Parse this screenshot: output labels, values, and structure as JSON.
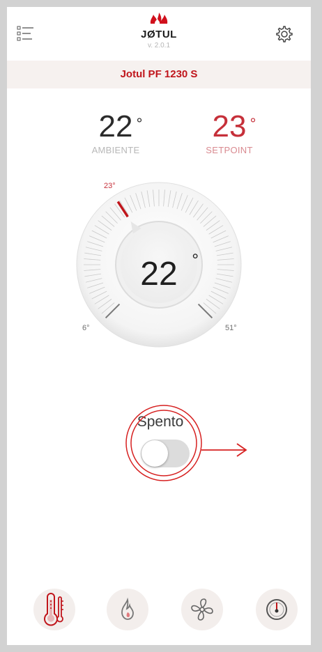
{
  "header": {
    "brand": "JØTUL",
    "version": "v. 2.0.1",
    "menu_icon": "menu-list-icon",
    "settings_icon": "gear-icon"
  },
  "device": {
    "name": "Jotul PF 1230 S"
  },
  "temperatures": {
    "ambient": {
      "value": "22",
      "unit": "°",
      "label": "AMBIENTE"
    },
    "setpoint": {
      "value": "23",
      "unit": "°",
      "label": "SETPOINT"
    }
  },
  "dial": {
    "current": "22",
    "unit": "°",
    "min_label": "6",
    "max_label": "51",
    "marker_label": "23",
    "min": 6,
    "max": 51,
    "setpoint": 23
  },
  "power": {
    "status": "Spento",
    "on": false
  },
  "bottom_nav": [
    {
      "icon": "thermometer-icon",
      "active": true
    },
    {
      "icon": "flame-icon",
      "active": false
    },
    {
      "icon": "fan-icon",
      "active": false
    },
    {
      "icon": "gauge-icon",
      "active": false
    }
  ],
  "colors": {
    "accent": "#c0151b",
    "setpoint": "#c6303a",
    "inactive": "#8a8a8a"
  }
}
